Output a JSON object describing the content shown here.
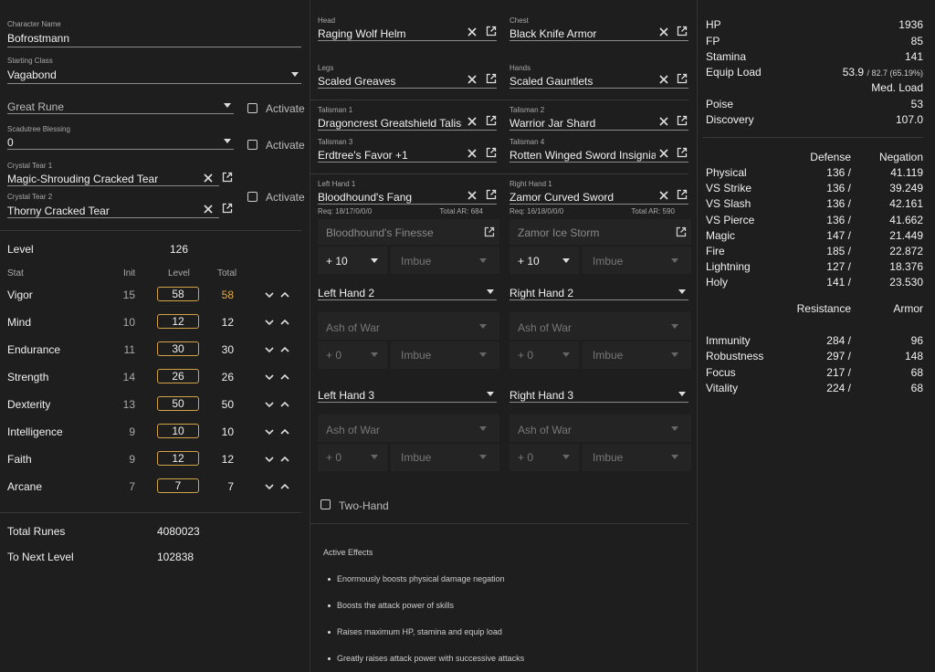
{
  "left": {
    "character_name": {
      "label": "Character Name",
      "value": "Bofrostmann"
    },
    "starting_class": {
      "label": "Starting Class",
      "value": "Vagabond"
    },
    "great_rune": {
      "value": "Great Rune",
      "activate": "Activate"
    },
    "scadutree": {
      "label": "Scadutree Blessing",
      "value": "0",
      "activate": "Activate"
    },
    "crystal_tear_1": {
      "label": "Crystal Tear 1",
      "value": "Magic-Shrouding Cracked Tear"
    },
    "crystal_tear_2": {
      "label": "Crystal Tear 2",
      "value": "Thorny Cracked Tear",
      "activate": "Activate"
    },
    "level": {
      "label": "Level",
      "value": "126"
    },
    "stat_headers": {
      "stat": "Stat",
      "init": "Init",
      "level": "Level",
      "total": "Total"
    },
    "stats": [
      {
        "name": "Vigor",
        "init": "15",
        "level": "58",
        "total": "58",
        "highlight": true
      },
      {
        "name": "Mind",
        "init": "10",
        "level": "12",
        "total": "12"
      },
      {
        "name": "Endurance",
        "init": "11",
        "level": "30",
        "total": "30"
      },
      {
        "name": "Strength",
        "init": "14",
        "level": "26",
        "total": "26"
      },
      {
        "name": "Dexterity",
        "init": "13",
        "level": "50",
        "total": "50"
      },
      {
        "name": "Intelligence",
        "init": "9",
        "level": "10",
        "total": "10"
      },
      {
        "name": "Faith",
        "init": "9",
        "level": "12",
        "total": "12"
      },
      {
        "name": "Arcane",
        "init": "7",
        "level": "7",
        "total": "7"
      }
    ],
    "total_runes": {
      "label": "Total Runes",
      "value": "4080023"
    },
    "to_next_level": {
      "label": "To Next Level",
      "value": "102838"
    }
  },
  "middle": {
    "head": {
      "label": "Head",
      "value": "Raging Wolf Helm"
    },
    "chest": {
      "label": "Chest",
      "value": "Black Knife Armor"
    },
    "legs": {
      "label": "Legs",
      "value": "Scaled Greaves"
    },
    "hands": {
      "label": "Hands",
      "value": "Scaled Gauntlets"
    },
    "talisman_1": {
      "label": "Talisman 1",
      "value": "Dragoncrest Greatshield Talisman"
    },
    "talisman_2": {
      "label": "Talisman 2",
      "value": "Warrior Jar Shard"
    },
    "talisman_3": {
      "label": "Talisman 3",
      "value": "Erdtree's Favor +1"
    },
    "talisman_4": {
      "label": "Talisman 4",
      "value": "Rotten Winged Sword Insignia"
    },
    "left_hand_1": {
      "label": "Left Hand 1",
      "value": "Bloodhound's Fang",
      "req": "Req: 18/17/0/0/0",
      "total_ar": "Total AR: 684",
      "ash": "Bloodhound's Finesse",
      "level": "+ 10",
      "imbue": "Imbue"
    },
    "right_hand_1": {
      "label": "Right Hand 1",
      "value": "Zamor Curved Sword",
      "req": "Req: 16/18/0/0/0",
      "total_ar": "Total AR: 590",
      "ash": "Zamor Ice Storm",
      "level": "+ 10",
      "imbue": "Imbue"
    },
    "left_hand_2": {
      "value": "Left Hand 2",
      "ash": "Ash of War",
      "level": "+ 0",
      "imbue": "Imbue"
    },
    "right_hand_2": {
      "value": "Right Hand 2",
      "ash": "Ash of War",
      "level": "+ 0",
      "imbue": "Imbue"
    },
    "left_hand_3": {
      "value": "Left Hand 3",
      "ash": "Ash of War",
      "level": "+ 0",
      "imbue": "Imbue"
    },
    "right_hand_3": {
      "value": "Right Hand 3",
      "ash": "Ash of War",
      "level": "+ 0",
      "imbue": "Imbue"
    },
    "two_hand": "Two-Hand",
    "active_effects": {
      "title": "Active Effects",
      "items": [
        "Enormously boosts physical damage negation",
        "Boosts the attack power of skills",
        "Raises maximum HP, stamina and equip load",
        "Greatly raises attack power with successive attacks"
      ]
    }
  },
  "right": {
    "hp": {
      "label": "HP",
      "value": "1936"
    },
    "fp": {
      "label": "FP",
      "value": "85"
    },
    "stamina": {
      "label": "Stamina",
      "value": "141"
    },
    "equip_load": {
      "label": "Equip Load",
      "value": "53.9",
      "suffix": "/ 82.7 (65.19%)",
      "status": "Med. Load"
    },
    "poise": {
      "label": "Poise",
      "value": "53"
    },
    "discovery": {
      "label": "Discovery",
      "value": "107.0"
    },
    "defense_header": {
      "defense": "Defense",
      "negation": "Negation"
    },
    "defense": [
      {
        "name": "Physical",
        "defense": "136 /",
        "negation": "41.119"
      },
      {
        "name": "VS Strike",
        "defense": "136 /",
        "negation": "39.249"
      },
      {
        "name": "VS Slash",
        "defense": "136 /",
        "negation": "42.161"
      },
      {
        "name": "VS Pierce",
        "defense": "136 /",
        "negation": "41.662"
      },
      {
        "name": "Magic",
        "defense": "147 /",
        "negation": "21.449"
      },
      {
        "name": "Fire",
        "defense": "185 /",
        "negation": "22.872"
      },
      {
        "name": "Lightning",
        "defense": "127 /",
        "negation": "18.376"
      },
      {
        "name": "Holy",
        "defense": "141 /",
        "negation": "23.530"
      }
    ],
    "resistance_header": {
      "resistance": "Resistance",
      "armor": "Armor"
    },
    "resistance": [
      {
        "name": "Immunity",
        "resistance": "284 /",
        "armor": "96"
      },
      {
        "name": "Robustness",
        "resistance": "297 /",
        "armor": "148"
      },
      {
        "name": "Focus",
        "resistance": "217 /",
        "armor": "68"
      },
      {
        "name": "Vitality",
        "resistance": "224 /",
        "armor": "68"
      }
    ]
  }
}
